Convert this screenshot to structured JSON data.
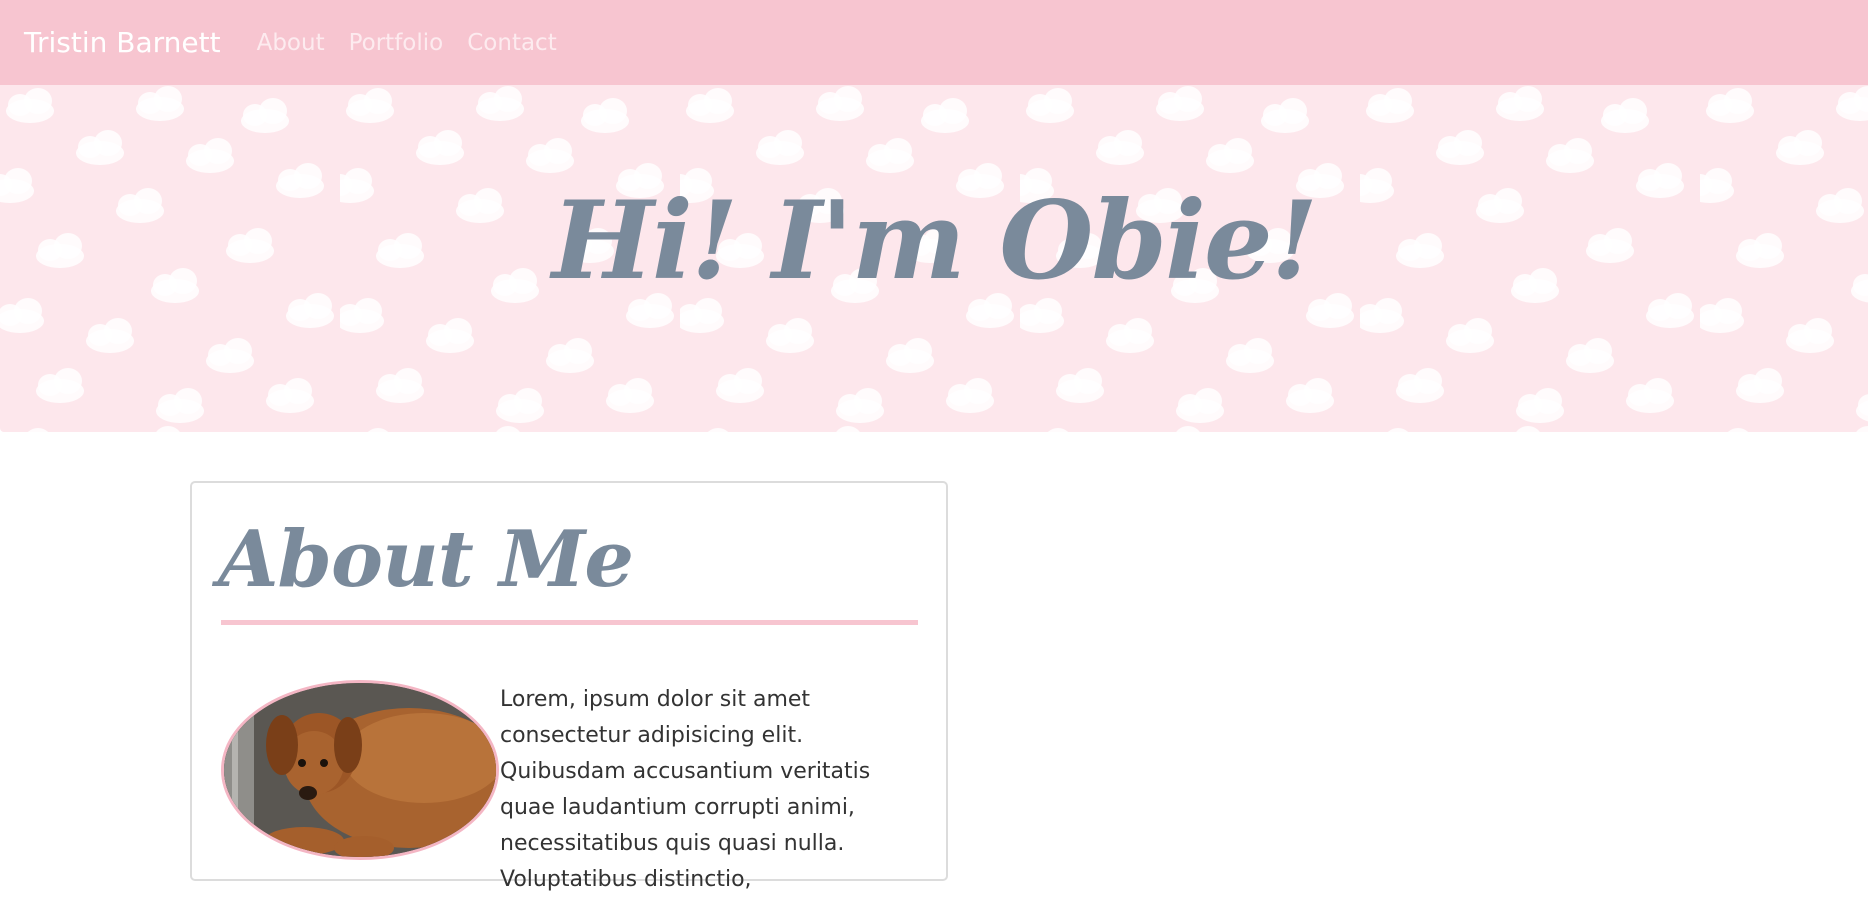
{
  "navbar": {
    "brand": "Tristin Barnett",
    "links": [
      "About",
      "Portfolio",
      "Contact"
    ]
  },
  "hero": {
    "title": "Hi! I'm Obie!"
  },
  "about": {
    "title": "About Me",
    "photo_alt": "dachshund-photo",
    "text": "Lorem, ipsum dolor sit amet consectetur adipisicing elit. Quibusdam accusantium veritatis quae laudantium corrupti animi, necessitatibus quis quasi nulla. Voluptatibus distinctio,"
  },
  "colors": {
    "navbar_bg": "#f7c5d0",
    "hero_bg": "#fde7ec",
    "heading": "#7a8a9b",
    "accent_rule": "#f7c5d0",
    "text": "#333333"
  }
}
